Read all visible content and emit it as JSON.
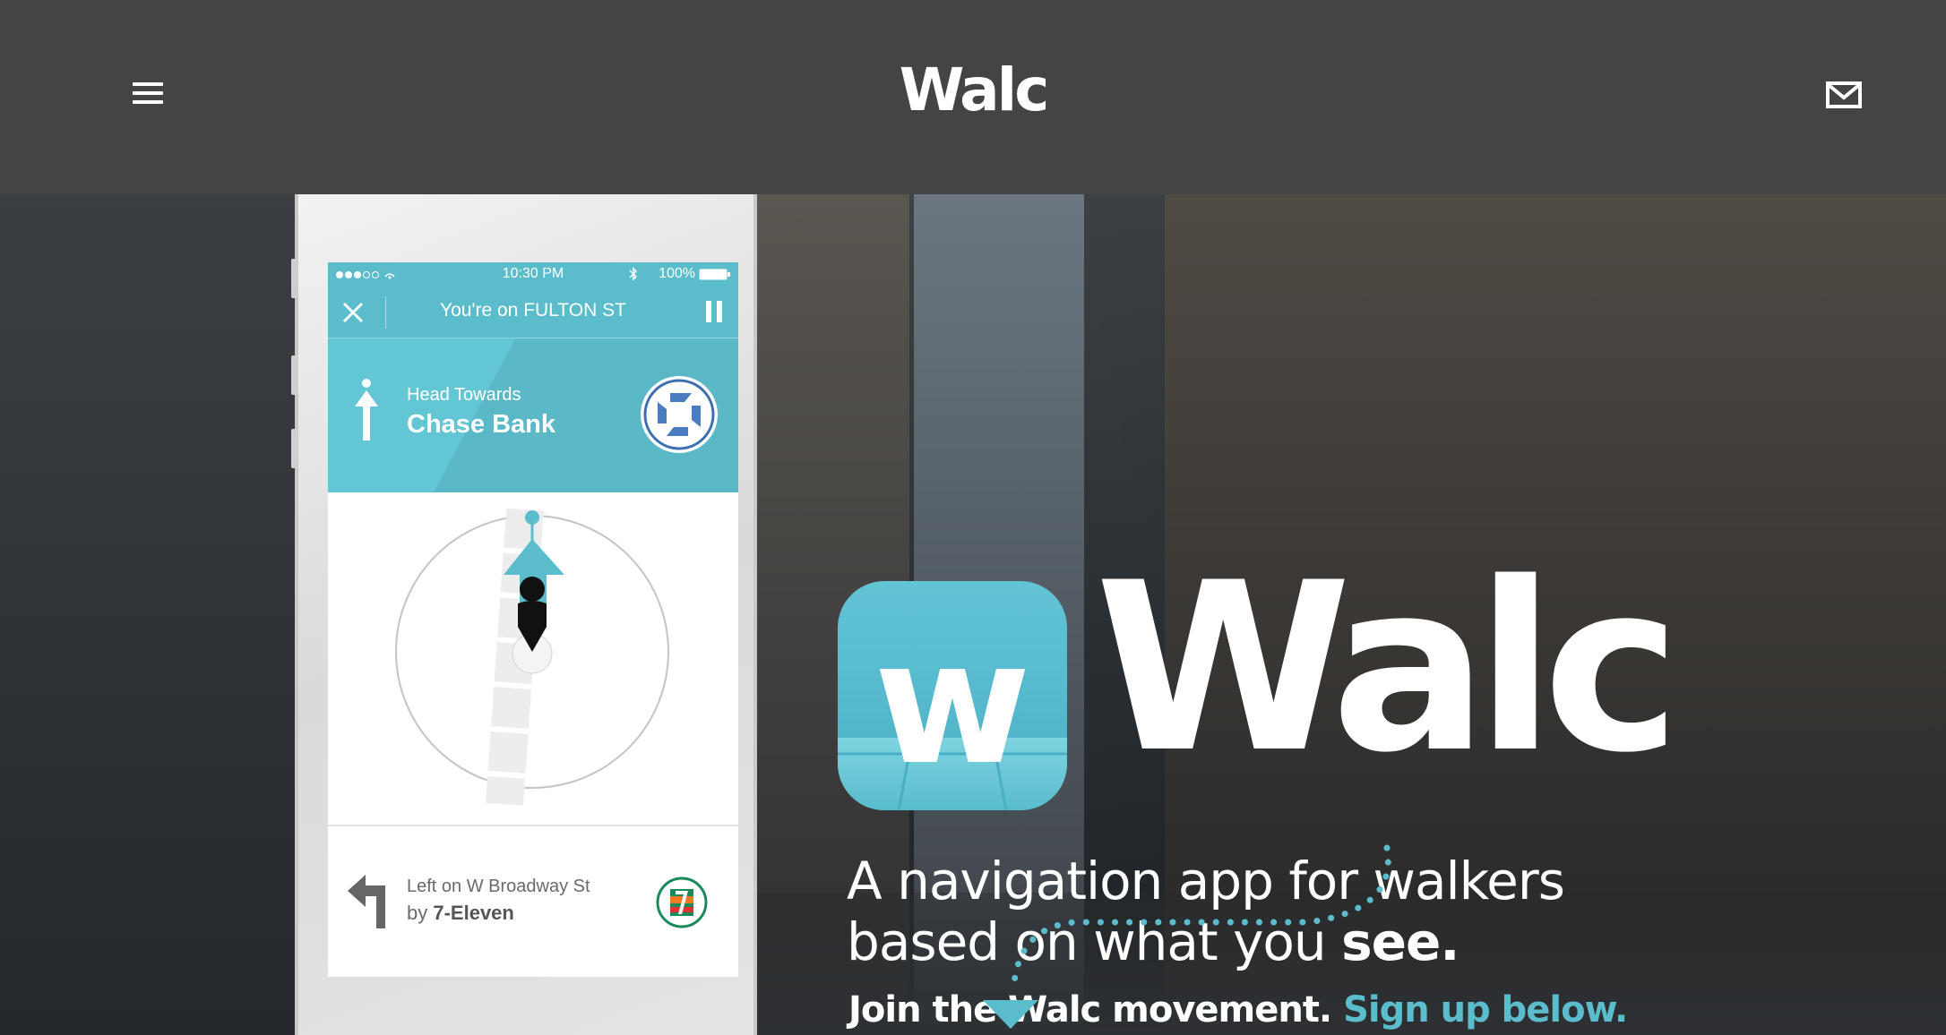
{
  "header": {
    "brand": "Walc",
    "menu_icon": "hamburger-menu-icon",
    "mail_icon": "envelope-icon"
  },
  "phone": {
    "status": {
      "time": "10:30 PM",
      "battery": "100%"
    },
    "nav": {
      "street": "You're on FULTON ST"
    },
    "current_direction": {
      "line1": "Head Towards",
      "line2": "Chase Bank",
      "landmark_icon": "chase-bank-logo"
    },
    "next_direction": {
      "line1": "Left on W Broadway St",
      "line2_prefix": "by ",
      "line2_bold": "7-Eleven",
      "landmark_icon": "7-eleven-logo"
    }
  },
  "hero": {
    "icon_letter": "w",
    "title": "Walc",
    "tagline_line1": "A navigation app for walkers",
    "tagline_line2_prefix": "based on what you ",
    "tagline_line2_bold": "see.",
    "join_text": "Join the Walc movement. ",
    "cta": "Sign up below."
  },
  "colors": {
    "accent": "#5bbccc",
    "header_bg": "#444444",
    "text": "#ffffff"
  }
}
